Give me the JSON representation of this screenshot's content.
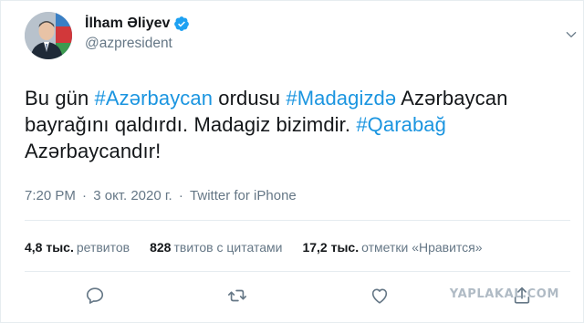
{
  "author": {
    "display_name": "İlham Əliyev",
    "handle": "@azpresident",
    "verified": true
  },
  "tweet": {
    "segments": [
      {
        "text": "Bu gün ",
        "hashtag": false
      },
      {
        "text": "#Azərbaycan",
        "hashtag": true
      },
      {
        "text": " ordusu ",
        "hashtag": false
      },
      {
        "text": "#Madagizdə",
        "hashtag": true
      },
      {
        "text": " Azərbaycan bayrağını qaldırdı. Madagiz bizimdir. ",
        "hashtag": false
      },
      {
        "text": "#Qarabağ",
        "hashtag": true
      },
      {
        "text": " Azərbaycandır!",
        "hashtag": false
      }
    ]
  },
  "meta": {
    "time": "7:20 PM",
    "separator": "·",
    "date": "3 окт. 2020 г.",
    "source": "Twitter for iPhone"
  },
  "stats": {
    "retweets_count": "4,8 тыс.",
    "retweets_label": "ретвитов",
    "quotes_count": "828",
    "quotes_label": "твитов с цитатами",
    "likes_count": "17,2 тыс.",
    "likes_label": "отметки «Нравится»"
  },
  "watermark": "YAPLAKAL.COM",
  "colors": {
    "hashtag": "#1b95e0",
    "secondary_text": "#657786",
    "primary_text": "#14171a",
    "verified_badge": "#1da1f2",
    "icon": "#657786"
  },
  "icons": [
    "verified-badge-icon",
    "chevron-down-icon",
    "reply-icon",
    "retweet-icon",
    "like-icon",
    "share-icon"
  ]
}
